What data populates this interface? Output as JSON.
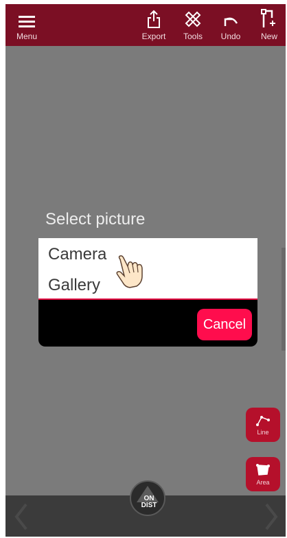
{
  "toolbar": {
    "menu_label": "Menu",
    "export_label": "Export",
    "tools_label": "Tools",
    "undo_label": "Undo",
    "new_label": "New"
  },
  "dialog": {
    "title": "Select picture",
    "options": [
      "Camera",
      "Gallery"
    ],
    "cancel_label": "Cancel"
  },
  "side_tools": {
    "line_label": "Line",
    "area_label": "Area"
  },
  "bottom": {
    "ondist_top": "ON",
    "ondist_bottom": "DIST"
  },
  "colors": {
    "toolbar": "#7b0f24",
    "accent": "#ff0d4d",
    "side_button": "#b5102b",
    "backdrop": "#7b7b7b"
  },
  "icons": [
    "menu-icon",
    "export-icon",
    "tools-icon",
    "undo-icon",
    "new-icon",
    "line-icon",
    "area-icon",
    "hand-pointer-icon",
    "ondist-icon",
    "chevron-left-icon",
    "chevron-right-icon"
  ]
}
